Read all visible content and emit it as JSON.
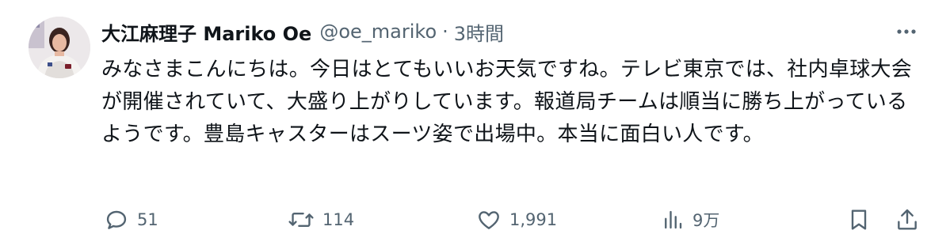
{
  "tweet": {
    "display_name": "大江麻理子 Mariko Oe",
    "handle": "@oe_mariko",
    "separator": "·",
    "time": "3時間",
    "text": "みなさまこんにちは。今日はとてもいいお天気ですね。テレビ東京では、社内卓球大会が開催されていて、大盛り上がりしています。報道局チームは順当に勝ち上がっているようです。豊島キャスターはスーツ姿で出場中。本当に面白い人です。"
  },
  "actions": {
    "reply": {
      "icon": "reply-icon",
      "count": "51"
    },
    "retweet": {
      "icon": "retweet-icon",
      "count": "114"
    },
    "like": {
      "icon": "heart-icon",
      "count": "1,991"
    },
    "views": {
      "icon": "bar-chart-icon",
      "count": "9万"
    },
    "bookmark": {
      "icon": "bookmark-icon"
    },
    "share": {
      "icon": "share-icon"
    }
  },
  "colors": {
    "text": "#0f1419",
    "secondary": "#536471",
    "background": "#ffffff"
  }
}
